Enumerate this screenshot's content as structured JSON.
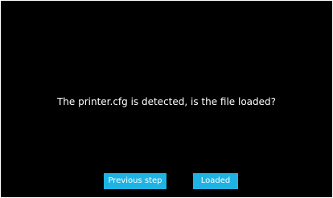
{
  "dialog": {
    "message": "The printer.cfg is detected, is the file loaded?",
    "previous_label": "Previous step",
    "loaded_label": "Loaded"
  },
  "colors": {
    "background": "#000000",
    "button": "#1fb3e3",
    "text": "#ffffff"
  }
}
